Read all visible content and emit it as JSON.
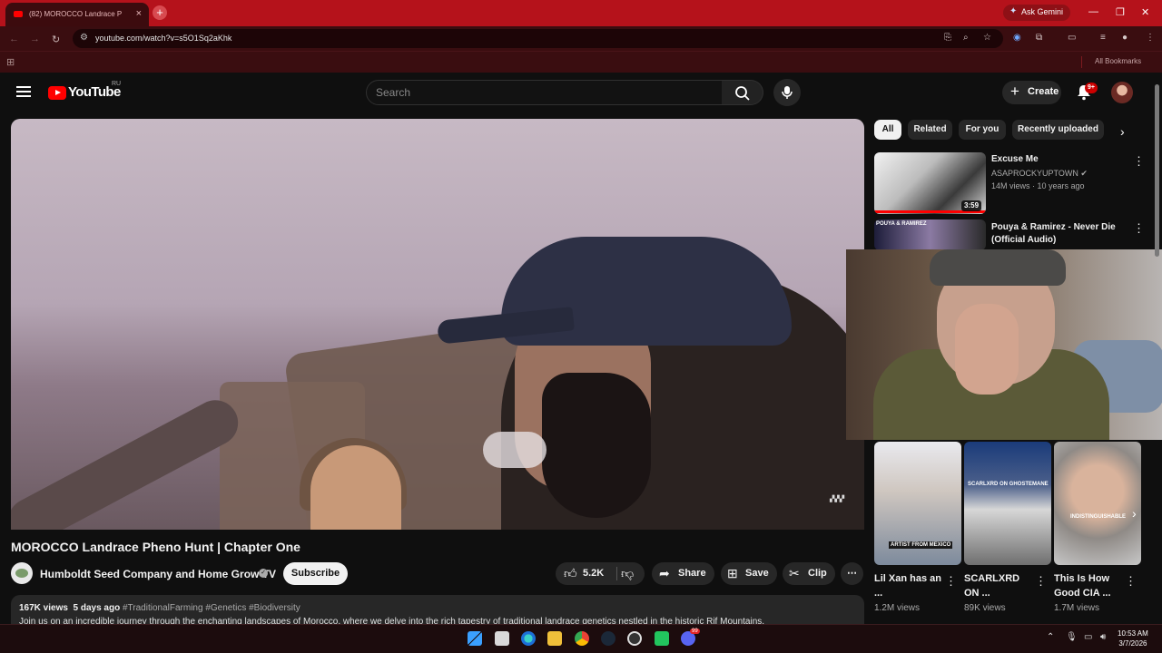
{
  "browser": {
    "tab_title": "(82) MOROCCO Landrace P",
    "url": "youtube.com/watch?v=s5O1Sq2aKhk",
    "gemini_button": "Ask Gemini",
    "all_bookmarks": "All Bookmarks"
  },
  "youtube": {
    "logo_text": "YouTube",
    "region": "RU",
    "search_placeholder": "Search",
    "create_label": "Create",
    "notification_badge": "9+"
  },
  "video": {
    "title": "MOROCCO Landrace Pheno Hunt | Chapter One",
    "channel_name": "Humboldt Seed Company and Home Grow TV",
    "subscribe_label": "Subscribe",
    "likes": "5.2K",
    "share_label": "Share",
    "save_label": "Save",
    "clip_label": "Clip",
    "views": "167K views",
    "age": "5 days ago",
    "hashtags": "#TraditionalFarming #Genetics #Biodiversity",
    "description": "Join us on an incredible journey through the enchanting landscapes of Morocco, where we delve into the rich tapestry of traditional landrace genetics nestled in the historic Rif Mountains."
  },
  "chips": [
    "All",
    "Related",
    "For you",
    "Recently uploaded"
  ],
  "recommendations": [
    {
      "title": "Excuse Me",
      "channel": "ASAPROCKYUPTOWN",
      "stats": "14M views · 10 years ago",
      "duration": "3:59"
    },
    {
      "title": "Pouya & Ramirez - Never Die (Official Audio)",
      "thumb_caption": "POUYA & RAMIREZ"
    }
  ],
  "shorts": [
    {
      "title": "Lil Xan has an ...",
      "views": "1.2M views",
      "caption": "ARTIST FROM MEXICO"
    },
    {
      "title": "SCARLXRD ON ...",
      "views": "89K views",
      "caption": "SCARLXRD ON GHOSTEMANE"
    },
    {
      "title": "This Is How Good CIA ...",
      "views": "1.7M views",
      "caption": "INDISTINGUISHABLE"
    }
  ],
  "taskbar": {
    "time": "10:53 AM",
    "date": "3/7/2026",
    "badge": "99"
  }
}
